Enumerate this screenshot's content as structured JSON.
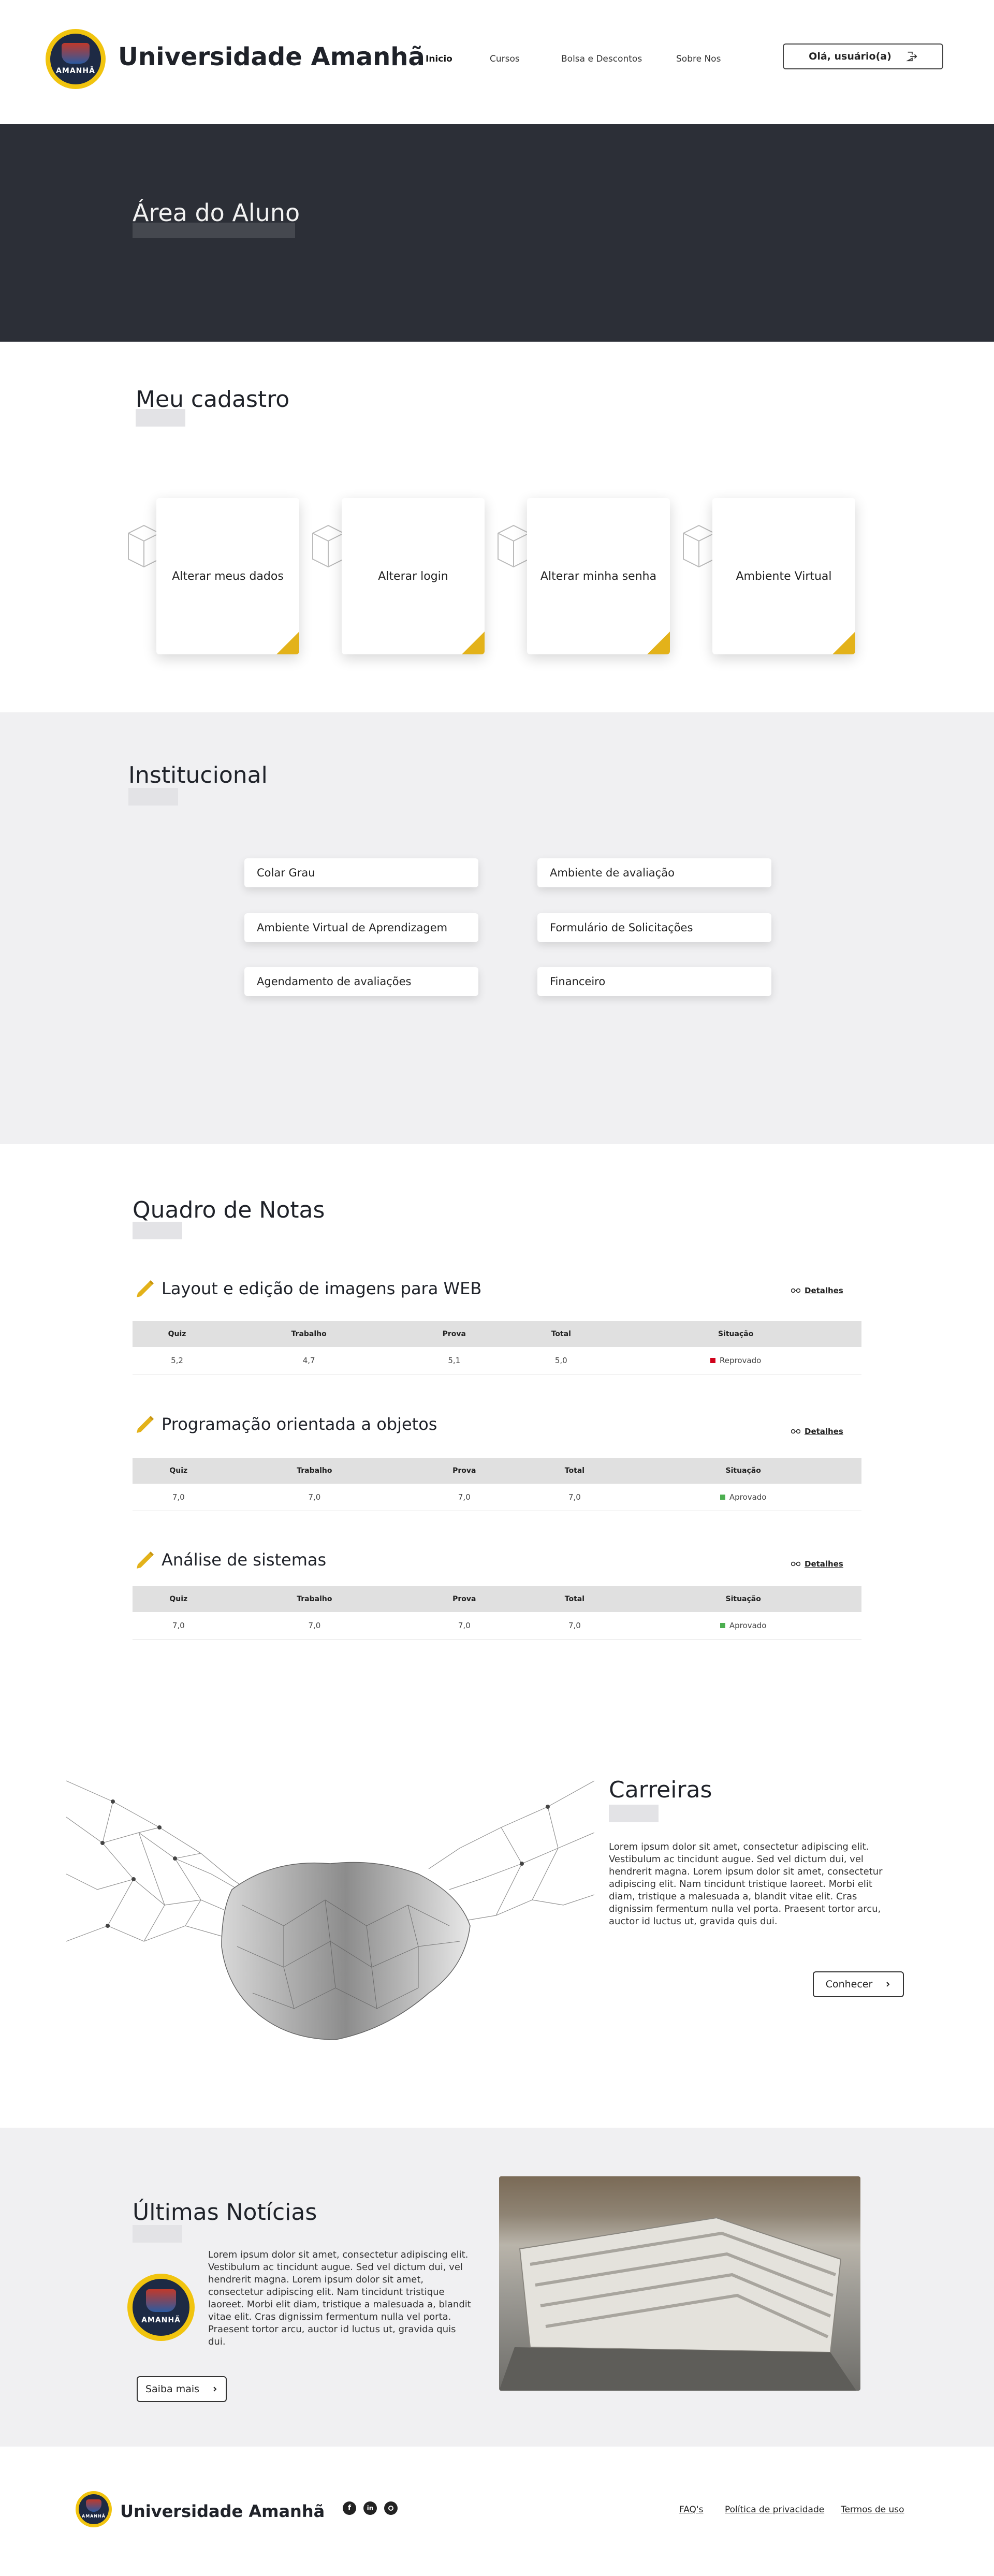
{
  "header": {
    "brand": "Universidade Amanhã",
    "logo_word": "AMANHÃ",
    "nav": [
      "Inicio",
      "Cursos",
      "Bolsa e Descontos",
      "Sobre Nos"
    ],
    "user_button": "Olá, usuário(a)"
  },
  "hero": {
    "title": "Área do Aluno"
  },
  "cadastro": {
    "title": "Meu cadastro",
    "cards": [
      "Alterar meus dados",
      "Alterar login",
      "Alterar minha senha",
      "Ambiente Virtual"
    ]
  },
  "institucional": {
    "title": "Institucional",
    "items": [
      "Colar Grau",
      "Ambiente de avaliação",
      "Ambiente Virtual de Aprendizagem",
      "Formulário de Solicitações",
      "Agendamento de avaliações",
      "Financeiro"
    ]
  },
  "notas": {
    "title": "Quadro de Notas",
    "details_label": "Detalhes",
    "columns": [
      "Quiz",
      "Trabalho",
      "Prova",
      "Total",
      "Situação"
    ],
    "disciplines": [
      {
        "name": "Layout e edição de imagens para WEB",
        "quiz": "5,2",
        "trabalho": "4,7",
        "prova": "5,1",
        "total": "5,0",
        "situacao": "Reprovado",
        "status_color": "#d0021b"
      },
      {
        "name": "Programação orientada a objetos",
        "quiz": "7,0",
        "trabalho": "7,0",
        "prova": "7,0",
        "total": "7,0",
        "situacao": "Aprovado",
        "status_color": "#4caf50"
      },
      {
        "name": "Análise de sistemas",
        "quiz": "7,0",
        "trabalho": "7,0",
        "prova": "7,0",
        "total": "7,0",
        "situacao": "Aprovado",
        "status_color": "#4caf50"
      }
    ]
  },
  "carreiras": {
    "title": "Carreiras",
    "text": "Lorem ipsum dolor sit amet, consectetur adipiscing elit. Vestibulum ac tincidunt augue. Sed vel dictum dui, vel hendrerit magna. Lorem ipsum dolor sit amet, consectetur adipiscing elit. Nam tincidunt tristique laoreet. Morbi elit diam, tristique a malesuada a, blandit vitae elit. Cras dignissim fermentum nulla vel porta. Praesent tortor arcu, auctor id luctus ut, gravida quis dui.",
    "button": "Conhecer"
  },
  "noticias": {
    "title": "Últimas Notícias",
    "text": "Lorem ipsum dolor sit amet, consectetur adipiscing elit. Vestibulum ac tincidunt augue. Sed vel dictum dui, vel hendrerit magna. Lorem ipsum dolor sit amet, consectetur adipiscing elit. Nam tincidunt tristique laoreet. Morbi elit diam, tristique a malesuada a, blandit vitae elit. Cras dignissim fermentum nulla vel porta. Praesent tortor arcu, auctor id luctus ut, gravida quis dui.",
    "button": "Saiba mais"
  },
  "footer": {
    "brand": "Universidade Amanhã",
    "links": [
      "FAQ's",
      "Política de privacidade",
      "Termos de uso"
    ]
  },
  "colors": {
    "accent": "#e3b21a",
    "hero_bg": "#2c2f37",
    "section_bg": "#f0f0f2"
  },
  "icons": [
    "logout-icon",
    "cube-icon",
    "pencil-icon",
    "glasses-icon",
    "chevron-right-icon",
    "facebook-icon",
    "linkedin-icon",
    "github-icon"
  ]
}
